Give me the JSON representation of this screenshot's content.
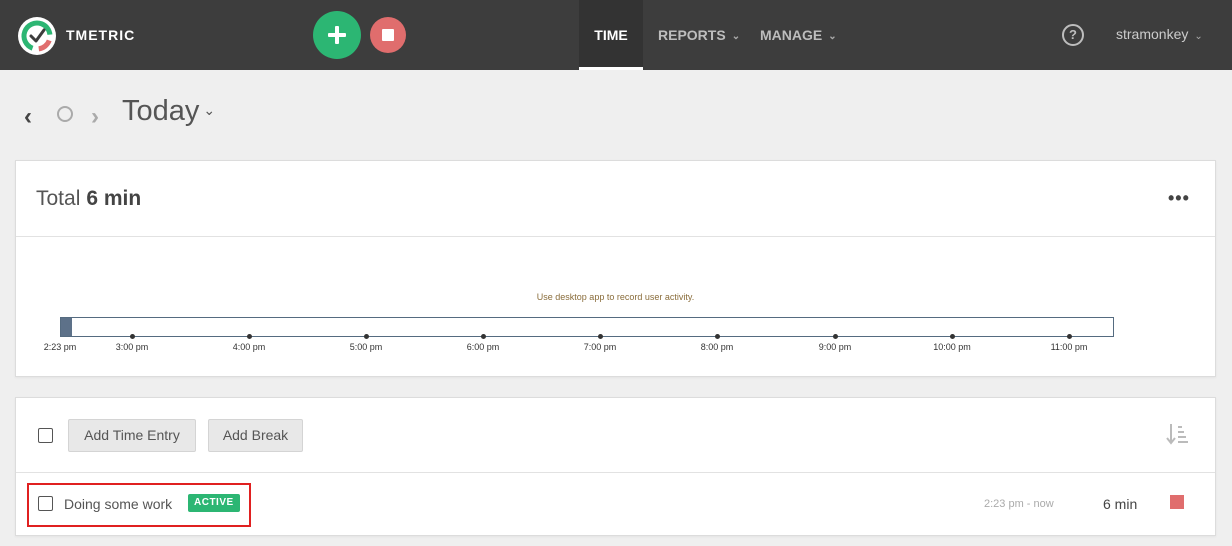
{
  "header": {
    "brand": "TMETRIC",
    "nav": [
      {
        "label": "TIME",
        "active": true
      },
      {
        "label": "REPORTS",
        "chevron": "⌄"
      },
      {
        "label": "MANAGE",
        "chevron": "⌄"
      }
    ],
    "help_label": "?",
    "user": "stramonkey",
    "user_chevron": "⌄",
    "start_icon": "plus-icon",
    "stop_icon": "stop-square-icon"
  },
  "date_nav": {
    "prev_icon": "‹",
    "next_icon": "›",
    "title": "Today",
    "chevron": "⌄"
  },
  "summary": {
    "total_label": "Total",
    "total_value": "6 min",
    "more_label": "•••",
    "activity_note": "Use desktop app to record user activity.",
    "timeline_start": "2:23 pm",
    "timeline_ticks": [
      "3:00 pm",
      "4:00 pm",
      "5:00 pm",
      "6:00 pm",
      "7:00 pm",
      "8:00 pm",
      "9:00 pm",
      "10:00 pm",
      "11:00 pm"
    ]
  },
  "entries": {
    "add_entry_label": "Add Time Entry",
    "add_break_label": "Add Break",
    "items": [
      {
        "description": "Doing some work",
        "badge": "ACTIVE",
        "range": "2:23 pm - now",
        "duration": "6 min"
      }
    ]
  },
  "colors": {
    "topbar": "#3d3d3d",
    "start_button": "#2cb673",
    "stop_button": "#e06d6d",
    "highlight_border": "#e02020"
  }
}
